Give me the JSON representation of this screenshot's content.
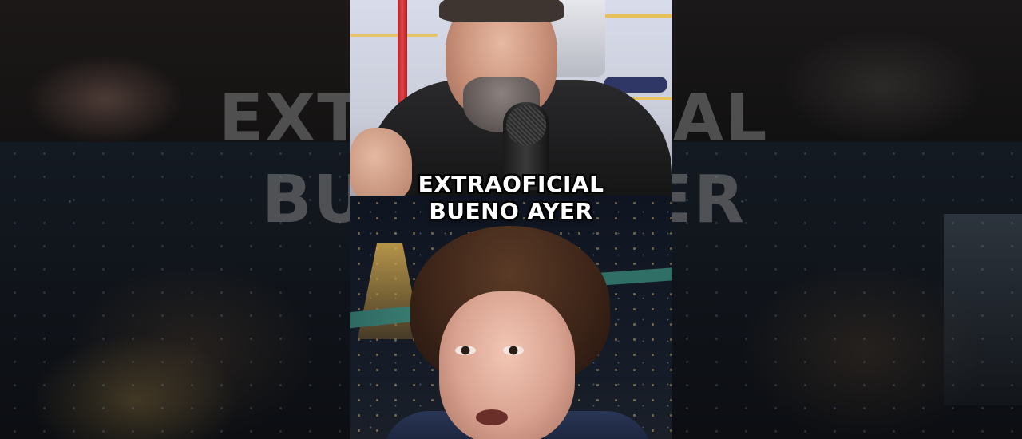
{
  "background": {
    "ghost_line_1": "EXTRAOFICIAL",
    "ghost_line_2": "BUENO AYER"
  },
  "caption": {
    "line_1": "EXTRAOFICIAL",
    "line_2": "BUENO AYER"
  },
  "colors": {
    "caption_text": "#ffffff",
    "caption_outline": "#000000",
    "studio_red": "#d83a40",
    "studio_accent_yellow": "#e6c15a"
  }
}
